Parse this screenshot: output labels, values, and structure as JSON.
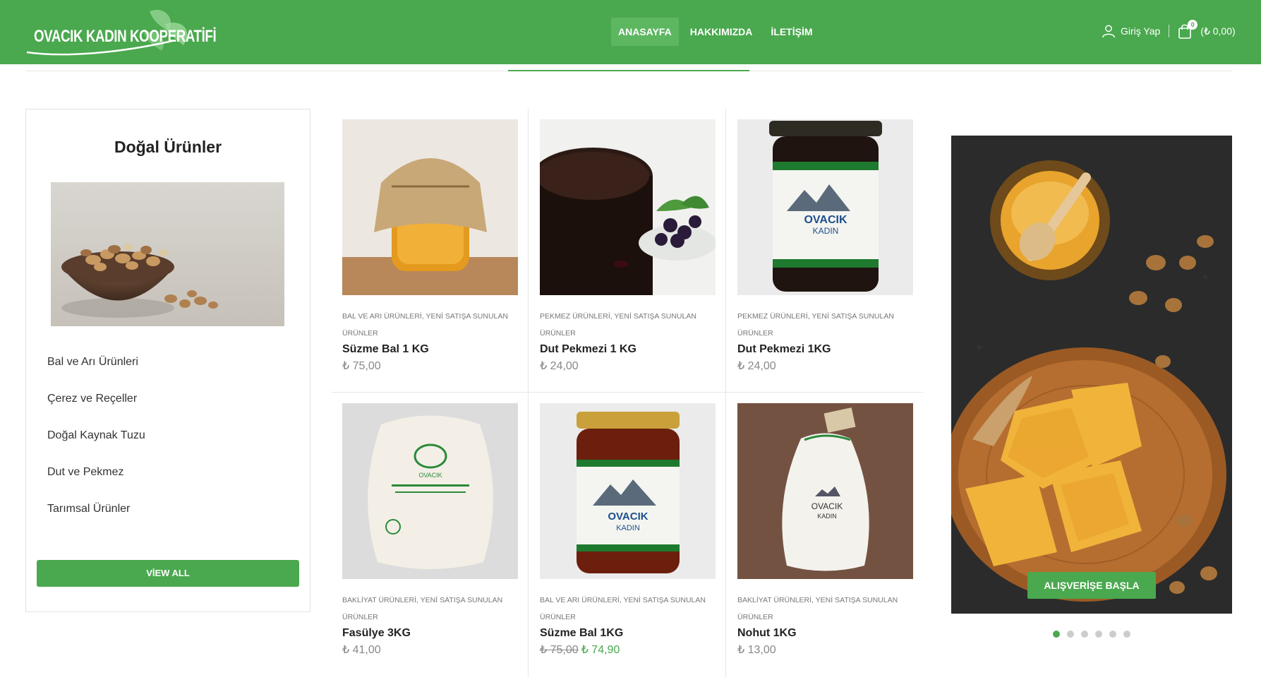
{
  "brand": {
    "name": "OVACIK KADIN KOOPERATİFİ"
  },
  "nav": [
    {
      "label": "ANASAYFA",
      "active": true
    },
    {
      "label": "HAKKIMIZDA",
      "active": false
    },
    {
      "label": "İLETİŞİM",
      "active": false
    }
  ],
  "account": {
    "login_label": "Giriş Yap",
    "cart_count": "0",
    "cart_total": "(₺ 0,00)"
  },
  "sidebar": {
    "title": "Doğal Ürünler",
    "items": [
      {
        "label": "Bal ve Arı Ürünleri"
      },
      {
        "label": "Çerez ve Reçeller"
      },
      {
        "label": "Doğal Kaynak Tuzu"
      },
      {
        "label": "Dut ve Pekmez"
      },
      {
        "label": "Tarımsal Ürünler"
      }
    ],
    "view_all_label": "VİEW ALL"
  },
  "products": [
    {
      "cats_1": "BAL VE ARI ÜRÜNLERİ, YENİ SATIŞA SUNULAN",
      "cats_2": "ÜRÜNLER",
      "name": "Süzme Bal 1 KG",
      "price": "₺ 75,00"
    },
    {
      "cats_1": "PEKMEZ ÜRÜNLERİ, YENİ SATIŞA SUNULAN",
      "cats_2": "ÜRÜNLER",
      "name": "Dut Pekmezi 1 KG",
      "price": "₺ 24,00"
    },
    {
      "cats_1": "PEKMEZ ÜRÜNLERİ, YENİ SATIŞA SUNULAN",
      "cats_2": "ÜRÜNLER",
      "name": "Dut Pekmezi 1KG",
      "price": "₺ 24,00"
    },
    {
      "cats_1": "BAKLİYAT ÜRÜNLERİ, YENİ SATIŞA SUNULAN",
      "cats_2": "ÜRÜNLER",
      "name": "Fasülye 3KG",
      "price": "₺ 41,00"
    },
    {
      "cats_1": "BAL VE ARI ÜRÜNLERİ, YENİ SATIŞA SUNULAN",
      "cats_2": "ÜRÜNLER",
      "name": "Süzme Bal 1KG",
      "old_price": "₺ 75,00",
      "price": "₺ 74,90"
    },
    {
      "cats_1": "BAKLİYAT ÜRÜNLERİ, YENİ SATIŞA SUNULAN",
      "cats_2": "ÜRÜNLER",
      "name": "Nohut 1KG",
      "price": "₺ 13,00"
    }
  ],
  "jar_label": {
    "line1": "OVACIK",
    "line2": "KADIN"
  },
  "banner": {
    "button_label": "ALIŞVERİŞE BAŞLA",
    "slide_count": 6,
    "active_slide": 1
  },
  "colors": {
    "brand_green": "#4aa84e",
    "nav_active": "#5db761"
  }
}
